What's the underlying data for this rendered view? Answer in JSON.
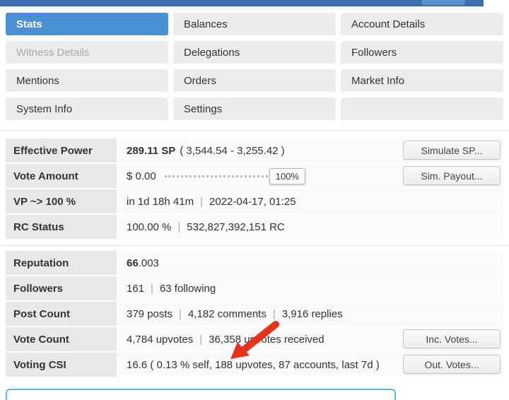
{
  "colors": {
    "accent": "#4a90d5",
    "topbar": "#3c6eb4",
    "arrow": "#e8311a",
    "panel": "#63b7d4"
  },
  "separator": "|",
  "tabs": [
    {
      "label": "Stats"
    },
    {
      "label": "Balances"
    },
    {
      "label": "Account Details"
    },
    {
      "label": "Witness Details"
    },
    {
      "label": "Delegations"
    },
    {
      "label": "Followers"
    },
    {
      "label": "Mentions"
    },
    {
      "label": "Orders"
    },
    {
      "label": "Market Info"
    },
    {
      "label": "System Info"
    },
    {
      "label": "Settings"
    }
  ],
  "stats": {
    "effective_power": {
      "label": "Effective Power",
      "value": "289.11 SP",
      "detail": "( 3,544.54 - 3,255.42 )",
      "button": "Simulate SP..."
    },
    "vote_amount": {
      "label": "Vote Amount",
      "value": "$ 0.00",
      "slider": "100%",
      "button": "Sim. Payout..."
    },
    "vp": {
      "label": "VP ~> 100 %",
      "time": "in 1d 18h 41m",
      "date": "2022-04-17, 01:25"
    },
    "rc": {
      "label": "RC Status",
      "percent": "100.00 %",
      "value": "532,827,392,151 RC"
    }
  },
  "account": {
    "reputation": {
      "label": "Reputation",
      "value": "66",
      "decimals": ".003"
    },
    "followers": {
      "label": "Followers",
      "count": "161",
      "following": "63 following"
    },
    "posts": {
      "label": "Post Count",
      "posts": "379 posts",
      "comments": "4,182 comments",
      "replies": "3,916 replies"
    },
    "votes": {
      "label": "Vote Count",
      "upvotes": "4,784 upvotes",
      "received": "36,358 upvotes received",
      "button": "Inc. Votes..."
    },
    "csi": {
      "label": "Voting CSI",
      "value": "16.6 ( 0.13 % self, 188 upvotes, 87 accounts, last 7d )",
      "button": "Out. Votes..."
    }
  }
}
